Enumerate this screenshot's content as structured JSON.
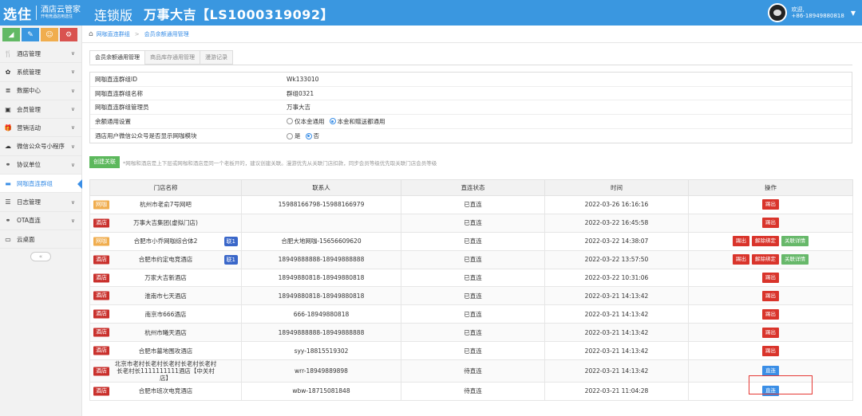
{
  "header": {
    "logo_main": "选住",
    "logo_sub1": "酒店云管家",
    "logo_sub2": "开电竞酒店用选住",
    "edition": "连锁版",
    "hotel": "万事大吉【LS1000319092】",
    "welcome": "欢迎,",
    "phone": "+86-18949880818",
    "caret": "▼"
  },
  "sidebar": {
    "tools": [
      {
        "icon": "◢",
        "color": "#62b965"
      },
      {
        "icon": "✎",
        "color": "#3a97e0"
      },
      {
        "icon": "☺",
        "color": "#f0ad4e"
      },
      {
        "icon": "⚙",
        "color": "#d9534f"
      }
    ],
    "items": [
      {
        "label": "酒店管理",
        "icon": "🍴"
      },
      {
        "label": "系统管理",
        "icon": "✿"
      },
      {
        "label": "数据中心",
        "icon": "≣"
      },
      {
        "label": "会员管理",
        "icon": "▣"
      },
      {
        "label": "营销活动",
        "icon": "🎁"
      },
      {
        "label": "微信公众号小程序",
        "icon": "☁"
      },
      {
        "label": "协议单位",
        "icon": "⚭"
      },
      {
        "label": "网咖直连群组",
        "icon": "▬"
      },
      {
        "label": "日志管理",
        "icon": "☰"
      },
      {
        "label": "OTA直连",
        "icon": "⚭"
      },
      {
        "label": "云桌面",
        "icon": "▭"
      }
    ],
    "chev": "∨",
    "collapse": "«"
  },
  "breadcrumb": {
    "home_icon": "⌂",
    "item1": "网咖直连群组",
    "sep": ">",
    "item2": "会员余额通用管理"
  },
  "tabs": [
    "会员余额通用管理",
    "商品库存通用管理",
    "漫游记录"
  ],
  "info": {
    "rows": [
      {
        "label": "网咖直连群组ID",
        "value": "Wk133010"
      },
      {
        "label": "网咖直连群组名称",
        "value": "群组0321"
      },
      {
        "label": "网咖直连群组管理员",
        "value": "万事大吉"
      }
    ],
    "balance_label": "余额通用设置",
    "balance_opts": [
      "仅本金通用",
      "本金和赠送都通用"
    ],
    "show_label": "酒店用户微信公众号是否显示网咖模块",
    "show_opts": [
      "是",
      "否"
    ]
  },
  "create": {
    "button": "创建关联",
    "note": "*网咖和酒店是上下层或网咖和酒店是同一个老板开的，建议创建关联。漫游优先从关联门店扣款，同步会员等级优先取关联门店会员等级"
  },
  "table": {
    "headers": [
      "门店名称",
      "联系人",
      "直连状态",
      "时间",
      "操作"
    ],
    "rows": [
      {
        "tag": "网咖",
        "tag_type": "net",
        "name": "杭州市老俞7号网吧",
        "lian": "",
        "contact": "15988166798-15988166979",
        "status": "已直连",
        "time": "2022-03-26 16:16:16",
        "ops": [
          {
            "label": "踢出",
            "color": "red"
          }
        ]
      },
      {
        "tag": "酒店",
        "tag_type": "hotel",
        "name": "万事大吉集团(虚拟门店)",
        "lian": "",
        "contact": "",
        "status": "已直连",
        "time": "2022-03-22 16:45:58",
        "ops": [
          {
            "label": "踢出",
            "color": "red"
          }
        ]
      },
      {
        "tag": "网咖",
        "tag_type": "net",
        "name": "合肥市小乔网咖综合体2",
        "lian": "联1",
        "contact": "合肥大地网咖-15656609620",
        "status": "已直连",
        "time": "2022-03-22 14:38:07",
        "ops": [
          {
            "label": "踢出",
            "color": "red"
          },
          {
            "label": "解除绑定",
            "color": "red"
          },
          {
            "label": "关联详情",
            "color": "green"
          }
        ]
      },
      {
        "tag": "酒店",
        "tag_type": "hotel",
        "name": "合肥市约定电竞酒店",
        "lian": "联1",
        "contact": "18949888888-18949888888",
        "status": "已直连",
        "time": "2022-03-22 13:57:50",
        "ops": [
          {
            "label": "踢出",
            "color": "red"
          },
          {
            "label": "解除绑定",
            "color": "red"
          },
          {
            "label": "关联详情",
            "color": "green"
          }
        ]
      },
      {
        "tag": "酒店",
        "tag_type": "hotel",
        "name": "万家大吉新酒店",
        "lian": "",
        "contact": "18949880818-18949880818",
        "status": "已直连",
        "time": "2022-03-22 10:31:06",
        "ops": [
          {
            "label": "踢出",
            "color": "red"
          }
        ]
      },
      {
        "tag": "酒店",
        "tag_type": "hotel",
        "name": "淮南市七天酒店",
        "lian": "",
        "contact": "18949880818-18949880818",
        "status": "已直连",
        "time": "2022-03-21 14:13:42",
        "ops": [
          {
            "label": "踢出",
            "color": "red"
          }
        ]
      },
      {
        "tag": "酒店",
        "tag_type": "hotel",
        "name": "南京市666酒店",
        "lian": "",
        "contact": "666-18949880818",
        "status": "已直连",
        "time": "2022-03-21 14:13:42",
        "ops": [
          {
            "label": "踢出",
            "color": "red"
          }
        ]
      },
      {
        "tag": "酒店",
        "tag_type": "hotel",
        "name": "杭州市曦天酒店",
        "lian": "",
        "contact": "18949888888-18949888888",
        "status": "已直连",
        "time": "2022-03-21 14:13:42",
        "ops": [
          {
            "label": "踢出",
            "color": "red"
          }
        ]
      },
      {
        "tag": "酒店",
        "tag_type": "hotel",
        "name": "合肥市墓地围攻酒店",
        "lian": "",
        "contact": "syy-18815519302",
        "status": "已直连",
        "time": "2022-03-21 14:13:42",
        "ops": [
          {
            "label": "踢出",
            "color": "red"
          }
        ]
      },
      {
        "tag": "酒店",
        "tag_type": "hotel",
        "name": "北京市老村长老村长老村长老村长老村长老村长1111111111酒店【中关村店】",
        "lian": "",
        "contact": "wrr-18949889898",
        "status": "待直连",
        "time": "2022-03-21 14:13:42",
        "ops": [
          {
            "label": "直连",
            "color": "blue"
          }
        ]
      },
      {
        "tag": "酒店",
        "tag_type": "hotel",
        "name": "合肥市班次电竞酒店",
        "lian": "",
        "contact": "wbw-18715081848",
        "status": "待直连",
        "time": "2022-03-21 11:04:28",
        "ops": [
          {
            "label": "直连",
            "color": "blue"
          }
        ]
      }
    ]
  }
}
